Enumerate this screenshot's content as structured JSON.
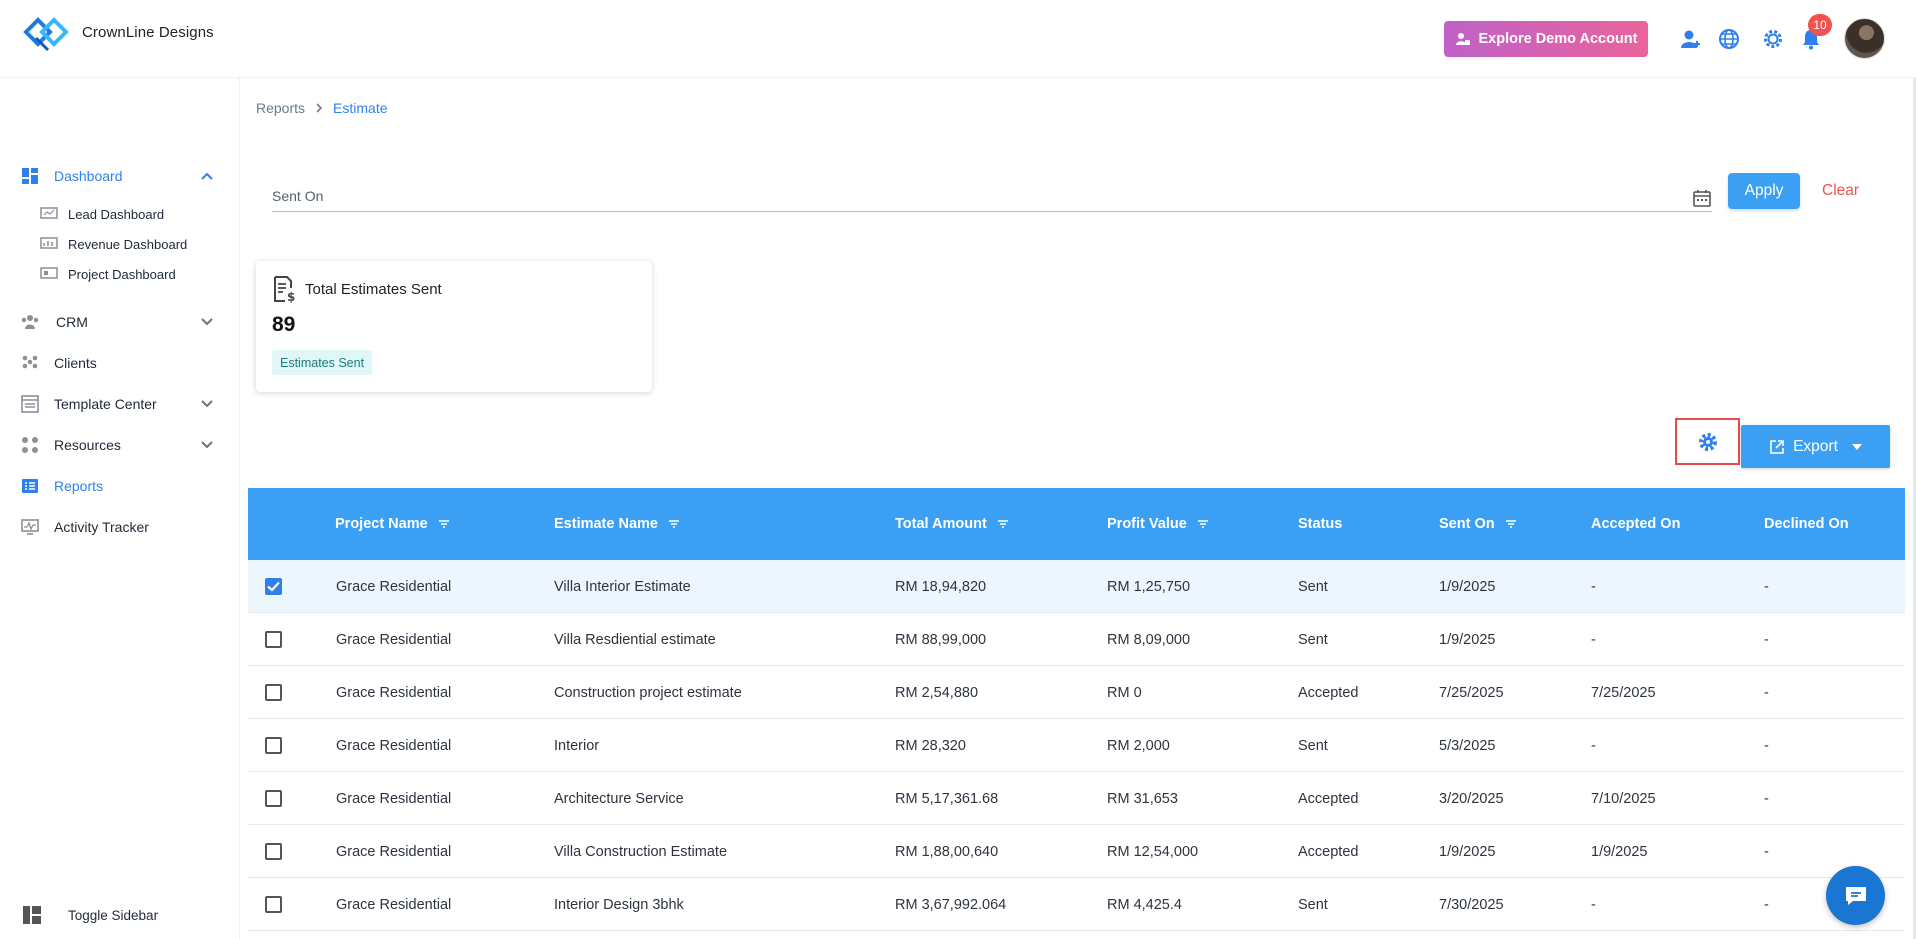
{
  "header": {
    "brand": "CrownLine Designs",
    "demo_button": "Explore Demo Account",
    "notifications_count": "10"
  },
  "sidebar": {
    "items": [
      {
        "label": "Dashboard",
        "icon": "dashboard-icon",
        "active": true,
        "expanded": true
      },
      {
        "label": "CRM",
        "icon": "crm-icon",
        "expandable": true
      },
      {
        "label": "Clients",
        "icon": "clients-icon"
      },
      {
        "label": "Template Center",
        "icon": "template-icon",
        "expandable": true
      },
      {
        "label": "Resources",
        "icon": "resources-icon",
        "expandable": true
      },
      {
        "label": "Reports",
        "icon": "reports-icon",
        "active": true
      },
      {
        "label": "Activity Tracker",
        "icon": "activity-icon"
      }
    ],
    "dashboard_sub": [
      {
        "label": "Lead Dashboard"
      },
      {
        "label": "Revenue Dashboard"
      },
      {
        "label": "Project Dashboard"
      }
    ],
    "toggle_label": "Toggle Sidebar"
  },
  "breadcrumb": {
    "parent": "Reports",
    "current": "Estimate"
  },
  "filter": {
    "label": "Sent On",
    "apply": "Apply",
    "clear": "Clear"
  },
  "stat_card": {
    "title": "Total Estimates Sent",
    "value": "89",
    "badge": "Estimates Sent"
  },
  "toolbar": {
    "export": "Export"
  },
  "table": {
    "columns": [
      "Project Name",
      "Estimate Name",
      "Total Amount",
      "Profit Value",
      "Status",
      "Sent On",
      "Accepted On",
      "Declined On"
    ],
    "rows": [
      {
        "checked": true,
        "project": "Grace Residential",
        "estimate": "Villa Interior Estimate",
        "amount": "RM 18,94,820",
        "profit": "RM 1,25,750",
        "status": "Sent",
        "sent": "1/9/2025",
        "accepted": "-",
        "declined": "-"
      },
      {
        "checked": false,
        "project": "Grace Residential",
        "estimate": "Villa Resdiential estimate",
        "amount": "RM 88,99,000",
        "profit": "RM 8,09,000",
        "status": "Sent",
        "sent": "1/9/2025",
        "accepted": "-",
        "declined": "-"
      },
      {
        "checked": false,
        "project": "Grace Residential",
        "estimate": "Construction project estimate",
        "amount": "RM 2,54,880",
        "profit": "RM 0",
        "status": "Accepted",
        "sent": "7/25/2025",
        "accepted": "7/25/2025",
        "declined": "-"
      },
      {
        "checked": false,
        "project": "Grace Residential",
        "estimate": "Interior",
        "amount": "RM 28,320",
        "profit": "RM 2,000",
        "status": "Sent",
        "sent": "5/3/2025",
        "accepted": "-",
        "declined": "-"
      },
      {
        "checked": false,
        "project": "Grace Residential",
        "estimate": "Architecture Service",
        "amount": "RM 5,17,361.68",
        "profit": "RM 31,653",
        "status": "Accepted",
        "sent": "3/20/2025",
        "accepted": "7/10/2025",
        "declined": "-"
      },
      {
        "checked": false,
        "project": "Grace Residential",
        "estimate": "Villa Construction Estimate",
        "amount": "RM 1,88,00,640",
        "profit": "RM 12,54,000",
        "status": "Accepted",
        "sent": "1/9/2025",
        "accepted": "1/9/2025",
        "declined": "-"
      },
      {
        "checked": false,
        "project": "Grace Residential",
        "estimate": "Interior Design 3bhk",
        "amount": "RM 3,67,992.064",
        "profit": "RM 4,425.4",
        "status": "Sent",
        "sent": "7/30/2025",
        "accepted": "-",
        "declined": "-"
      }
    ]
  },
  "colors": {
    "accent": "#3ba0f3",
    "active_nav": "#2f80ed",
    "danger": "#f0524f"
  }
}
